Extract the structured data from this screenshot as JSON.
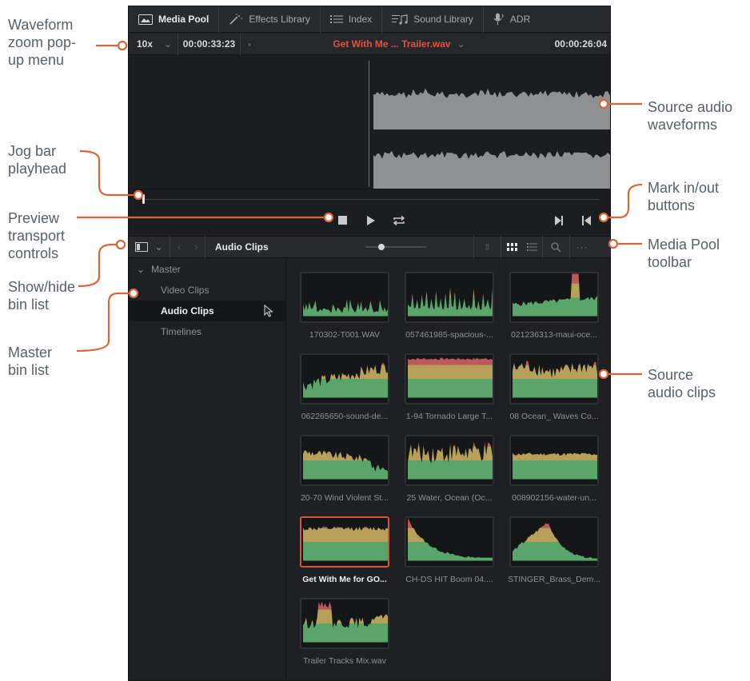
{
  "callouts": {
    "waveform_zoom": [
      "Waveform",
      "zoom pop-",
      "up menu"
    ],
    "jog_bar": [
      "Jog bar",
      "playhead"
    ],
    "preview_transport": [
      "Preview",
      "transport",
      "controls"
    ],
    "show_hide_bin": [
      "Show/hide",
      "bin list"
    ],
    "master_bin": [
      "Master",
      "bin list"
    ],
    "source_waveforms": [
      "Source audio",
      "waveforms"
    ],
    "mark_inout": [
      "Mark in/out",
      "buttons"
    ],
    "mp_toolbar": [
      "Media Pool",
      "toolbar"
    ],
    "source_clips": [
      "Source",
      "audio clips"
    ]
  },
  "tabs": [
    {
      "label": "Media Pool",
      "icon": "media-pool-icon",
      "active": true
    },
    {
      "label": "Effects Library",
      "icon": "effects-wand-icon",
      "active": false
    },
    {
      "label": "Index",
      "icon": "index-list-icon",
      "active": false
    },
    {
      "label": "Sound Library",
      "icon": "sound-library-icon",
      "active": false
    },
    {
      "label": "ADR",
      "icon": "adr-microphone-icon",
      "active": false
    }
  ],
  "viewer": {
    "zoom": "10x",
    "timecode_left": "00:00:33:23",
    "clip_name": "Get With Me ... Trailer.wav",
    "timecode_right": "00:00:26:04"
  },
  "media_pool": {
    "current_bin": "Audio Clips",
    "bins": [
      {
        "label": "Master",
        "level": "master",
        "selected": false
      },
      {
        "label": "Video Clips",
        "level": "sub",
        "selected": false
      },
      {
        "label": "Audio Clips",
        "level": "sub",
        "selected": true
      },
      {
        "label": "Timelines",
        "level": "sub",
        "selected": false
      }
    ],
    "clips": [
      {
        "name": "170302-T001.WAV",
        "selected": false
      },
      {
        "name": "057461985-spacious-...",
        "selected": false
      },
      {
        "name": "021236313-maui-oce...",
        "selected": false
      },
      {
        "name": "062265650-sound-de...",
        "selected": false
      },
      {
        "name": "1-94 Tornado Large T...",
        "selected": false
      },
      {
        "name": "08 Ocean_ Waves Co...",
        "selected": false
      },
      {
        "name": "20-70 Wind Violent St...",
        "selected": false
      },
      {
        "name": "25 Water, Ocean (Oc...",
        "selected": false
      },
      {
        "name": "008902156-water-un...",
        "selected": false
      },
      {
        "name": "Get With Me for GO...",
        "selected": true
      },
      {
        "name": "CH-DS HIT Boom 04....",
        "selected": false
      },
      {
        "name": "STINGER_Brass_Dem...",
        "selected": false
      },
      {
        "name": "Trailer Tracks Mix.wav",
        "selected": false
      }
    ]
  },
  "colors": {
    "accent": "#e2533f",
    "callout_line": "#d9653a",
    "waveform_fill": "#8e9092",
    "clip_wave_green": "#5aa56a",
    "clip_wave_yellow": "#b8a05a",
    "clip_wave_red": "#c0575a"
  }
}
